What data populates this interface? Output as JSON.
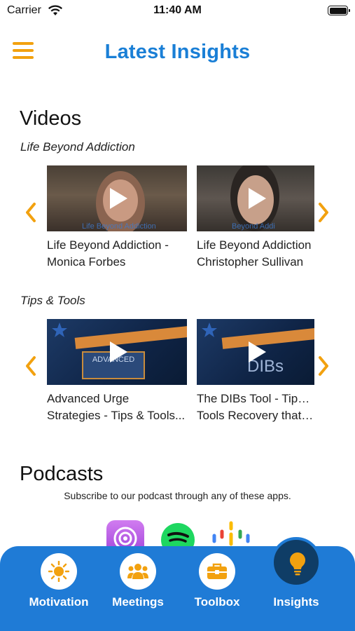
{
  "status_bar": {
    "carrier": "Carrier",
    "time": "11:40 AM"
  },
  "header": {
    "title": "Latest Insights",
    "menu_icon": "hamburger-menu-icon"
  },
  "videos": {
    "title": "Videos",
    "categories": [
      {
        "name": "Life Beyond Addiction",
        "items": [
          {
            "title": "Life Beyond Addiction - Monica Forbes",
            "line1": "Life Beyond Addiction -",
            "line2": "Monica Forbes",
            "watermark": "Life Beyond Addiction"
          },
          {
            "title": "Life Beyond Addiction Christopher Sullivan",
            "line1": "Life Beyond Addiction",
            "line2": "Christopher Sullivan",
            "watermark": "Beyond Addi"
          }
        ]
      },
      {
        "name": "Tips & Tools",
        "items": [
          {
            "title": "Advanced Urge Strategies - Tips & Tools...",
            "line1": "Advanced Urge",
            "line2": "Strategies - Tips & Tools...",
            "overlay": "ADVANCED"
          },
          {
            "title": "The DIBs Tool - Tips & Tools Recovery that ...",
            "line1": "The DIBs Tool - Tips &",
            "line2": "Tools Recovery that ...",
            "overlay": "DIBs"
          }
        ]
      }
    ]
  },
  "podcasts": {
    "title": "Podcasts",
    "subtitle": "Subscribe to our podcast through any of these apps.",
    "apps": [
      "apple-podcasts-icon",
      "spotify-icon",
      "google-podcasts-icon"
    ]
  },
  "tab_bar": {
    "tabs": [
      {
        "label": "Motivation",
        "icon": "sun-icon",
        "active": false
      },
      {
        "label": "Meetings",
        "icon": "people-group-icon",
        "active": false
      },
      {
        "label": "Toolbox",
        "icon": "toolbox-icon",
        "active": false
      },
      {
        "label": "Insights",
        "icon": "lightbulb-icon",
        "active": true
      }
    ]
  },
  "colors": {
    "accent": "#f2a10f",
    "brand_blue": "#1a7fd6",
    "tab_bar": "#1f7bd6",
    "active_tab": "#0f3d66"
  }
}
